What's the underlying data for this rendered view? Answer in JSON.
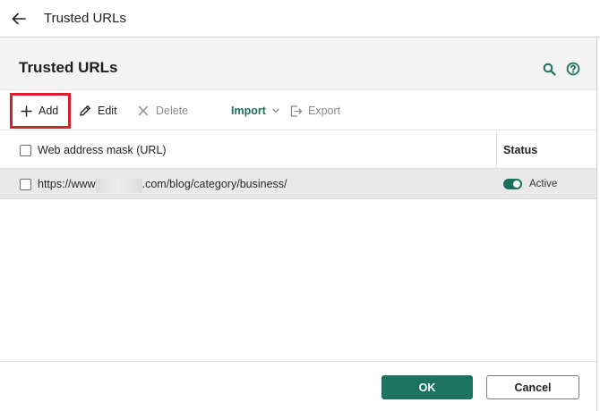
{
  "window": {
    "title": "Trusted URLs"
  },
  "panel": {
    "title": "Trusted URLs"
  },
  "header_icons": [
    "search-icon",
    "help-icon"
  ],
  "toolbar": {
    "add_label": "Add",
    "edit_label": "Edit",
    "delete_label": "Delete",
    "import_label": "Import",
    "export_label": "Export"
  },
  "table": {
    "columns": {
      "url": "Web address mask (URL)",
      "status": "Status"
    },
    "rows": [
      {
        "url_prefix": "https://www",
        "url_suffix": ".com/blog/category/business/",
        "status": "Active",
        "enabled": true,
        "checked": false
      }
    ]
  },
  "footer": {
    "ok_label": "OK",
    "cancel_label": "Cancel"
  },
  "colors": {
    "accent": "#1d7360",
    "highlight": "#d8202a",
    "header_bg": "#f3f3f3",
    "row_bg": "#e9e9e9"
  }
}
